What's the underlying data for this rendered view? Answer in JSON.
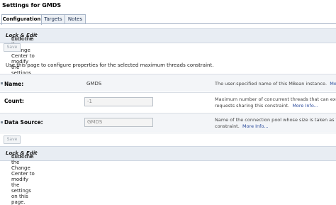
{
  "page": {
    "title": "Settings for GMDS"
  },
  "tabs": [
    {
      "label": "Configuration"
    },
    {
      "label": "Targets"
    },
    {
      "label": "Notes"
    }
  ],
  "change_center_msg": {
    "prefix": "Click the ",
    "emphasis": "Lock & Edit",
    "suffix": " button in the Change Center to modify the settings on this page."
  },
  "toolbar": {
    "save_label": "Save"
  },
  "intro": "Use this page to configure properties for the selected maximum threads constraint.",
  "fields": [
    {
      "label": "Name:",
      "value": "GMDS",
      "desc_line1": "The user-specified name of this MBean instance.",
      "more": "More In"
    },
    {
      "label": "Count:",
      "input_value": "-1",
      "desc_line1": "Maximum number of concurrent threads that can execute",
      "desc_line2": "requests sharing this constraint.",
      "more": "More Info..."
    },
    {
      "label": "Data Source:",
      "input_value": "GMDS",
      "desc_line1": "Name of the connection pool whose size is taken as the m",
      "desc_line2": "constraint.",
      "more": "More Info..."
    }
  ],
  "icons": {
    "field_marker": "small-field-marker-icon"
  }
}
